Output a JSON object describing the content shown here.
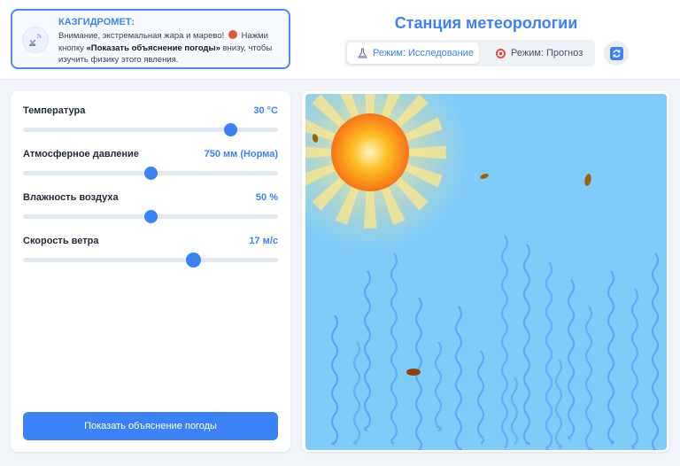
{
  "header": {
    "alert": {
      "title": "КАЗГИДРОМЕТ:",
      "text_before": "Внимание, экстремальная жара и марево! ",
      "text_mid": " Нажми кнопку ",
      "text_bold": "«Показать объяснение погоды»",
      "text_after": " внизу, чтобы изучить физику этого явления."
    },
    "title": "Станция метеорологии",
    "modes": [
      {
        "label": "Режим: Исследование",
        "active": true,
        "icon": "flask-icon"
      },
      {
        "label": "Режим: Прогноз",
        "active": false,
        "icon": "target-icon"
      }
    ],
    "refresh_icon": "refresh-icon"
  },
  "controls": {
    "sliders": [
      {
        "label": "Температура",
        "value_text": "30 °C",
        "position": 0.815
      },
      {
        "label": "Атмосферное давление",
        "value_text": "750 мм (Норма)",
        "position": 0.5
      },
      {
        "label": "Влажность воздуха",
        "value_text": "50 %",
        "position": 0.5
      },
      {
        "label": "Скорость ветра",
        "value_text": "17 м/с",
        "position": 0.67
      }
    ],
    "explain_button": "Показать объяснение погоды"
  },
  "scene": {
    "sky_color": "#80ccf9",
    "accent": "#3b82f6"
  }
}
